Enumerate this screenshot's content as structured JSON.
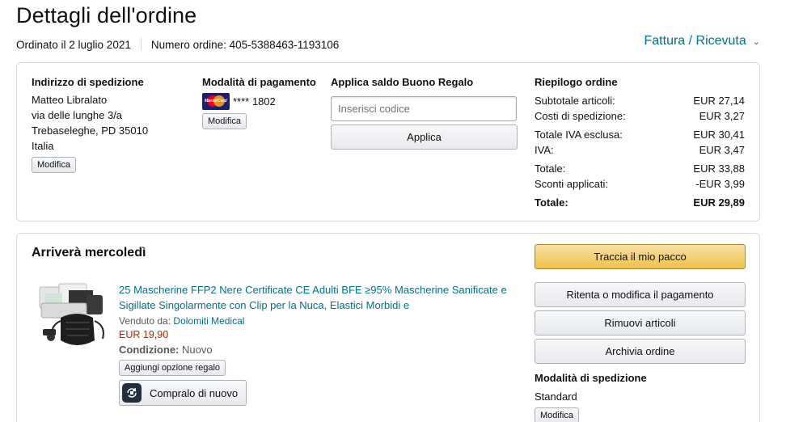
{
  "header": {
    "title": "Dettagli dell'ordine",
    "ordered_on": "Ordinato il 2 luglio 2021",
    "order_number": "Numero ordine: 405-5388463-1193106",
    "invoice_link": "Fattura / Ricevuta"
  },
  "shipping_address": {
    "title": "Indirizzo di spedizione",
    "lines": [
      "Matteo Libralato",
      "via delle lunghe 3/a",
      "Trebaseleghe, PD 35010",
      "Italia"
    ],
    "edit_label": "Modifica"
  },
  "payment": {
    "title": "Modalità di pagamento",
    "card_text": "**** 1802",
    "card_brand": "MasterCard",
    "edit_label": "Modifica"
  },
  "gift_card": {
    "title": "Applica saldo Buono Regalo",
    "placeholder": "Inserisci codice",
    "apply_label": "Applica"
  },
  "summary": {
    "title": "Riepilogo ordine",
    "rows": [
      {
        "label": "Subtotale articoli:",
        "value": "EUR 27,14"
      },
      {
        "label": "Costi di spedizione:",
        "value": "EUR 3,27"
      },
      {
        "label": "Totale IVA esclusa:",
        "value": "EUR 30,41"
      },
      {
        "label": "IVA:",
        "value": "EUR 3,47"
      },
      {
        "label": "Totale:",
        "value": "EUR 33,88"
      },
      {
        "label": "Sconti applicati:",
        "value": "-EUR 3,99"
      },
      {
        "label": "Totale:",
        "value": "EUR 29,89"
      }
    ]
  },
  "shipment": {
    "status": "Arriverà mercoledì",
    "product": {
      "title": "25 Mascherine FFP2 Nere Certificate CE Adulti BFE ≥95% Mascherine Sanificate e Sigillate Singolarmente con Clip per la Nuca, Elastici Morbidi e",
      "sold_by_label": "Venduto da:",
      "seller": "Dolomiti Medical",
      "price": "EUR 19,90",
      "condition_label": "Condizione:",
      "condition": "Nuovo",
      "gift_option_label": "Aggiungi opzione regalo",
      "buy_again_label": "Compralo di nuovo"
    },
    "actions": {
      "track": "Traccia il mio pacco",
      "retry_payment": "Ritenta o modifica il pagamento",
      "remove_items": "Rimuovi articoli",
      "archive": "Archivia ordine"
    },
    "shipping_method": {
      "title": "Modalità di spedizione",
      "value": "Standard",
      "edit_label": "Modifica"
    }
  },
  "colors": {
    "link": "#007185",
    "price": "#b12704",
    "button_yellow": "#f0c14b",
    "border": "#d5d9d9"
  }
}
